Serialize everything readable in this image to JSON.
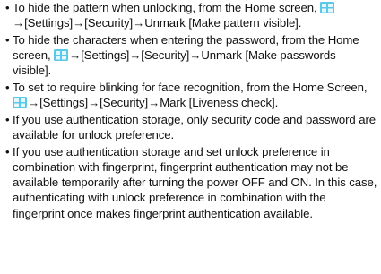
{
  "bullet_glyph": "•",
  "icon": "apps-grid-icon",
  "icon_color": "#59c9e8",
  "items": [
    {
      "before": "To hide the pattern when unlocking, from the Home screen, ",
      "after": "→[Settings]→[Security]→Unmark [Make pattern visible]."
    },
    {
      "before": "To hide the characters when entering the password, from the Home screen, ",
      "after": "→[Settings]→[Security]→Unmark [Make passwords visible]."
    },
    {
      "before": "To set to require blinking for face recognition, from the Home Screen, ",
      "after": "→[Settings]→[Security]→Mark [Liveness check]."
    },
    {
      "text": "If you use authentication storage, only security code and password are available for unlock preference."
    },
    {
      "text": "If you use authentication storage and set unlock preference in combination with fingerprint, fingerprint authentication may not be available temporarily after turning the power OFF and ON. In this case, authenticating with unlock preference in combination with the fingerprint once makes fingerprint authentication available."
    }
  ]
}
